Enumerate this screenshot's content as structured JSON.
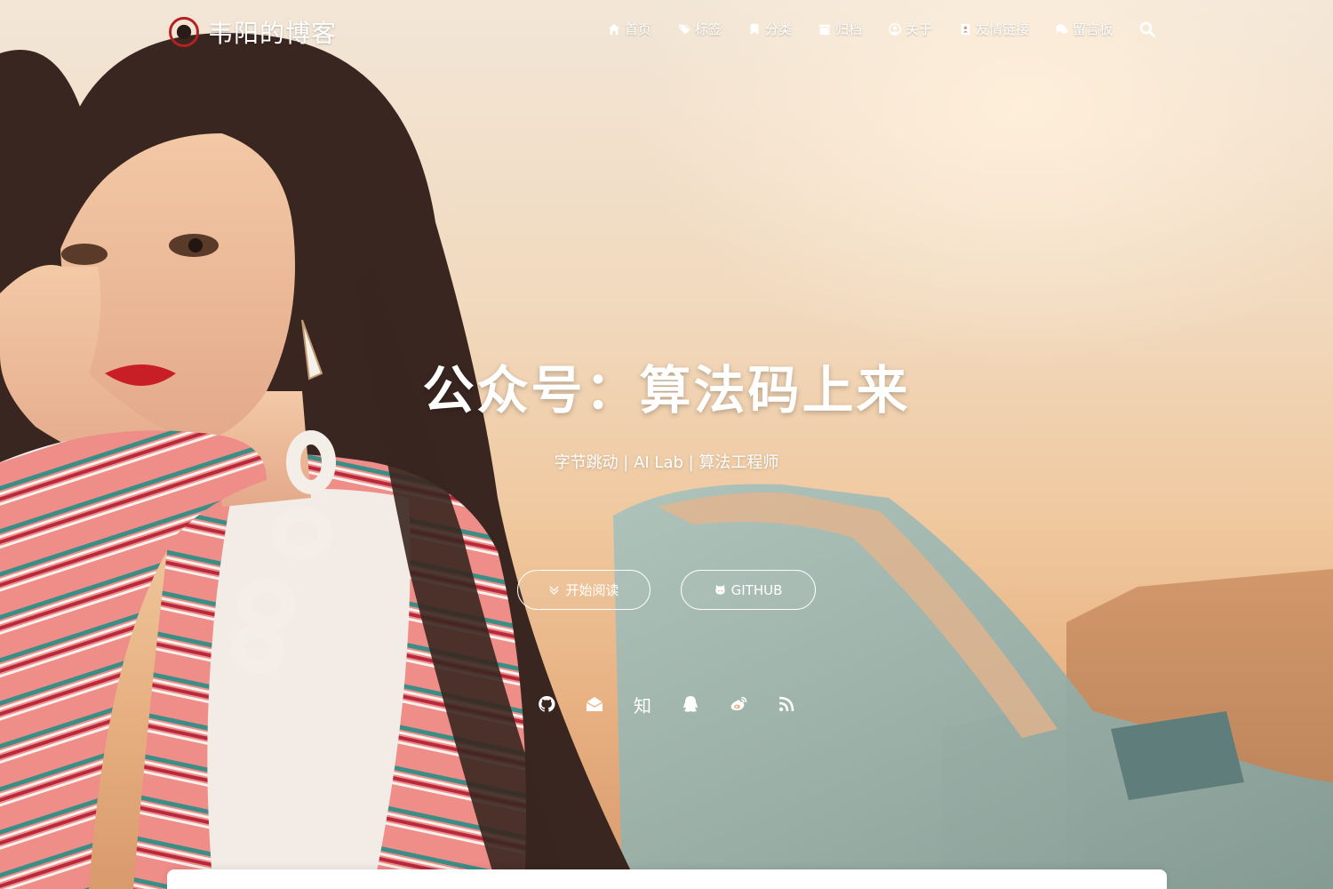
{
  "brand": {
    "title": "韦阳的博客",
    "logo_icon": "avatar-logo"
  },
  "nav": {
    "items": [
      {
        "label": "首页",
        "icon": "home-icon"
      },
      {
        "label": "标签",
        "icon": "tags-icon"
      },
      {
        "label": "分类",
        "icon": "bookmark-icon"
      },
      {
        "label": "归档",
        "icon": "archive-icon"
      },
      {
        "label": "关于",
        "icon": "user-circle-icon"
      },
      {
        "label": "友情链接",
        "icon": "address-book-icon"
      },
      {
        "label": "留言板",
        "icon": "comments-icon"
      }
    ],
    "search_icon": "search-icon"
  },
  "hero": {
    "title": "公众号：算法码上来",
    "subtitle": "字节跳动 | AI Lab | 算法工程师",
    "buttons": {
      "read_label": "开始阅读",
      "github_label": "GITHUB"
    },
    "social": [
      {
        "name": "github",
        "icon": "github-icon"
      },
      {
        "name": "email",
        "icon": "envelope-icon"
      },
      {
        "name": "zhihu",
        "icon": "zhihu-icon",
        "glyph": "知"
      },
      {
        "name": "qq",
        "icon": "qq-icon"
      },
      {
        "name": "weibo",
        "icon": "weibo-icon"
      },
      {
        "name": "rss",
        "icon": "rss-icon"
      }
    ]
  },
  "colors": {
    "text": "#ffffff",
    "sky_top": "#f2e6d7",
    "sky_bottom": "#d99a6c",
    "sweater_pink": "#ee8a86",
    "hair": "#3a2620",
    "car": "#8fb3b0"
  }
}
